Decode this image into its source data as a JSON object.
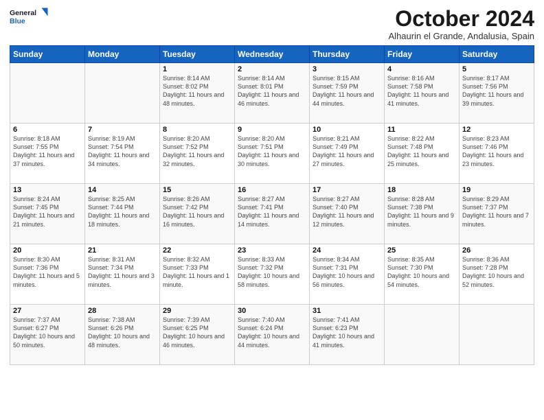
{
  "header": {
    "logo_line1": "General",
    "logo_line2": "Blue",
    "month": "October 2024",
    "location": "Alhaurin el Grande, Andalusia, Spain"
  },
  "weekdays": [
    "Sunday",
    "Monday",
    "Tuesday",
    "Wednesday",
    "Thursday",
    "Friday",
    "Saturday"
  ],
  "weeks": [
    [
      {
        "day": "",
        "text": ""
      },
      {
        "day": "",
        "text": ""
      },
      {
        "day": "1",
        "text": "Sunrise: 8:14 AM\nSunset: 8:02 PM\nDaylight: 11 hours and 48 minutes."
      },
      {
        "day": "2",
        "text": "Sunrise: 8:14 AM\nSunset: 8:01 PM\nDaylight: 11 hours and 46 minutes."
      },
      {
        "day": "3",
        "text": "Sunrise: 8:15 AM\nSunset: 7:59 PM\nDaylight: 11 hours and 44 minutes."
      },
      {
        "day": "4",
        "text": "Sunrise: 8:16 AM\nSunset: 7:58 PM\nDaylight: 11 hours and 41 minutes."
      },
      {
        "day": "5",
        "text": "Sunrise: 8:17 AM\nSunset: 7:56 PM\nDaylight: 11 hours and 39 minutes."
      }
    ],
    [
      {
        "day": "6",
        "text": "Sunrise: 8:18 AM\nSunset: 7:55 PM\nDaylight: 11 hours and 37 minutes."
      },
      {
        "day": "7",
        "text": "Sunrise: 8:19 AM\nSunset: 7:54 PM\nDaylight: 11 hours and 34 minutes."
      },
      {
        "day": "8",
        "text": "Sunrise: 8:20 AM\nSunset: 7:52 PM\nDaylight: 11 hours and 32 minutes."
      },
      {
        "day": "9",
        "text": "Sunrise: 8:20 AM\nSunset: 7:51 PM\nDaylight: 11 hours and 30 minutes."
      },
      {
        "day": "10",
        "text": "Sunrise: 8:21 AM\nSunset: 7:49 PM\nDaylight: 11 hours and 27 minutes."
      },
      {
        "day": "11",
        "text": "Sunrise: 8:22 AM\nSunset: 7:48 PM\nDaylight: 11 hours and 25 minutes."
      },
      {
        "day": "12",
        "text": "Sunrise: 8:23 AM\nSunset: 7:46 PM\nDaylight: 11 hours and 23 minutes."
      }
    ],
    [
      {
        "day": "13",
        "text": "Sunrise: 8:24 AM\nSunset: 7:45 PM\nDaylight: 11 hours and 21 minutes."
      },
      {
        "day": "14",
        "text": "Sunrise: 8:25 AM\nSunset: 7:44 PM\nDaylight: 11 hours and 18 minutes."
      },
      {
        "day": "15",
        "text": "Sunrise: 8:26 AM\nSunset: 7:42 PM\nDaylight: 11 hours and 16 minutes."
      },
      {
        "day": "16",
        "text": "Sunrise: 8:27 AM\nSunset: 7:41 PM\nDaylight: 11 hours and 14 minutes."
      },
      {
        "day": "17",
        "text": "Sunrise: 8:27 AM\nSunset: 7:40 PM\nDaylight: 11 hours and 12 minutes."
      },
      {
        "day": "18",
        "text": "Sunrise: 8:28 AM\nSunset: 7:38 PM\nDaylight: 11 hours and 9 minutes."
      },
      {
        "day": "19",
        "text": "Sunrise: 8:29 AM\nSunset: 7:37 PM\nDaylight: 11 hours and 7 minutes."
      }
    ],
    [
      {
        "day": "20",
        "text": "Sunrise: 8:30 AM\nSunset: 7:36 PM\nDaylight: 11 hours and 5 minutes."
      },
      {
        "day": "21",
        "text": "Sunrise: 8:31 AM\nSunset: 7:34 PM\nDaylight: 11 hours and 3 minutes."
      },
      {
        "day": "22",
        "text": "Sunrise: 8:32 AM\nSunset: 7:33 PM\nDaylight: 11 hours and 1 minute."
      },
      {
        "day": "23",
        "text": "Sunrise: 8:33 AM\nSunset: 7:32 PM\nDaylight: 10 hours and 58 minutes."
      },
      {
        "day": "24",
        "text": "Sunrise: 8:34 AM\nSunset: 7:31 PM\nDaylight: 10 hours and 56 minutes."
      },
      {
        "day": "25",
        "text": "Sunrise: 8:35 AM\nSunset: 7:30 PM\nDaylight: 10 hours and 54 minutes."
      },
      {
        "day": "26",
        "text": "Sunrise: 8:36 AM\nSunset: 7:28 PM\nDaylight: 10 hours and 52 minutes."
      }
    ],
    [
      {
        "day": "27",
        "text": "Sunrise: 7:37 AM\nSunset: 6:27 PM\nDaylight: 10 hours and 50 minutes."
      },
      {
        "day": "28",
        "text": "Sunrise: 7:38 AM\nSunset: 6:26 PM\nDaylight: 10 hours and 48 minutes."
      },
      {
        "day": "29",
        "text": "Sunrise: 7:39 AM\nSunset: 6:25 PM\nDaylight: 10 hours and 46 minutes."
      },
      {
        "day": "30",
        "text": "Sunrise: 7:40 AM\nSunset: 6:24 PM\nDaylight: 10 hours and 44 minutes."
      },
      {
        "day": "31",
        "text": "Sunrise: 7:41 AM\nSunset: 6:23 PM\nDaylight: 10 hours and 41 minutes."
      },
      {
        "day": "",
        "text": ""
      },
      {
        "day": "",
        "text": ""
      }
    ]
  ]
}
